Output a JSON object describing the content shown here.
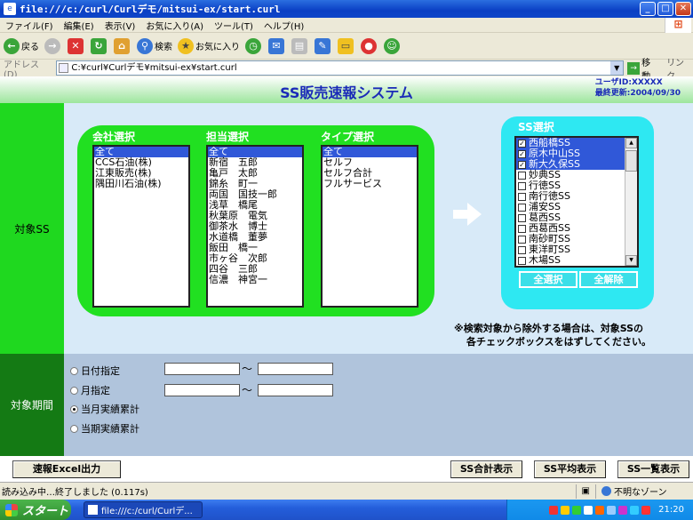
{
  "window": {
    "title": "file:///c:/curl/Curlデモ/mitsui-ex/start.curl"
  },
  "menu": [
    "ファイル(F)",
    "編集(E)",
    "表示(V)",
    "お気に入り(A)",
    "ツール(T)",
    "ヘルプ(H)"
  ],
  "toolbar": {
    "back": "戻る",
    "search": "検索",
    "favorites": "お気に入り"
  },
  "address": {
    "label": "アドレス(D)",
    "url": "C:¥curl¥Curlデモ¥mitsui-ex¥start.curl",
    "go": "移動",
    "links": "リンク"
  },
  "header": {
    "title": "SS販売速報システム",
    "user": "ユーザID:XXXXX",
    "updated": "最終更新:2004/09/30"
  },
  "section_ss": {
    "label": "対象SS"
  },
  "section_period": {
    "label": "対象期間"
  },
  "company": {
    "title": "会社選択",
    "items": [
      "全て",
      "CCS石油(株)",
      "江東販売(株)",
      "隅田川石油(株)"
    ]
  },
  "staff": {
    "title": "担当選択",
    "items": [
      "全て",
      "新宿　五郎",
      "亀戸　太郎",
      "錦糸　町一",
      "両国　国技一郎",
      "浅草　橋尾",
      "秋葉原　電気",
      "御茶水　博士",
      "水道橋　董夢",
      "飯田　橋一",
      "市ヶ谷　次郎",
      "四谷　三郎",
      "信濃　神宮一"
    ]
  },
  "type": {
    "title": "タイプ選択",
    "items": [
      "全て",
      "セルフ",
      "セルフ合計",
      "フルサービス"
    ]
  },
  "ss": {
    "title": "SS選択",
    "items": [
      "西船橋SS",
      "原木中山SS",
      "新大久保SS",
      "妙典SS",
      "行徳SS",
      "南行徳SS",
      "浦安SS",
      "葛西SS",
      "西葛西SS",
      "南砂町SS",
      "東洋町SS",
      "木場SS"
    ],
    "select_all": "全選択",
    "clear_all": "全解除"
  },
  "note": {
    "line1": "※検索対象から除外する場合は、対象SSの",
    "line2": "各チェックボックスをはずしてください。"
  },
  "period": {
    "options": [
      "日付指定",
      "月指定",
      "当月実績累計",
      "当期実績累計"
    ],
    "tilde": "〜"
  },
  "buttons": {
    "excel": "速報Excel出力",
    "sum": "SS合計表示",
    "avg": "SS平均表示",
    "list": "SS一覧表示"
  },
  "status": {
    "text": "読み込み中…終了しました (0.117s)",
    "zone": "不明なゾーン"
  },
  "taskbar": {
    "start": "スタート",
    "item": "file:///c:/curl/Curlデ...",
    "clock": "21:20"
  }
}
